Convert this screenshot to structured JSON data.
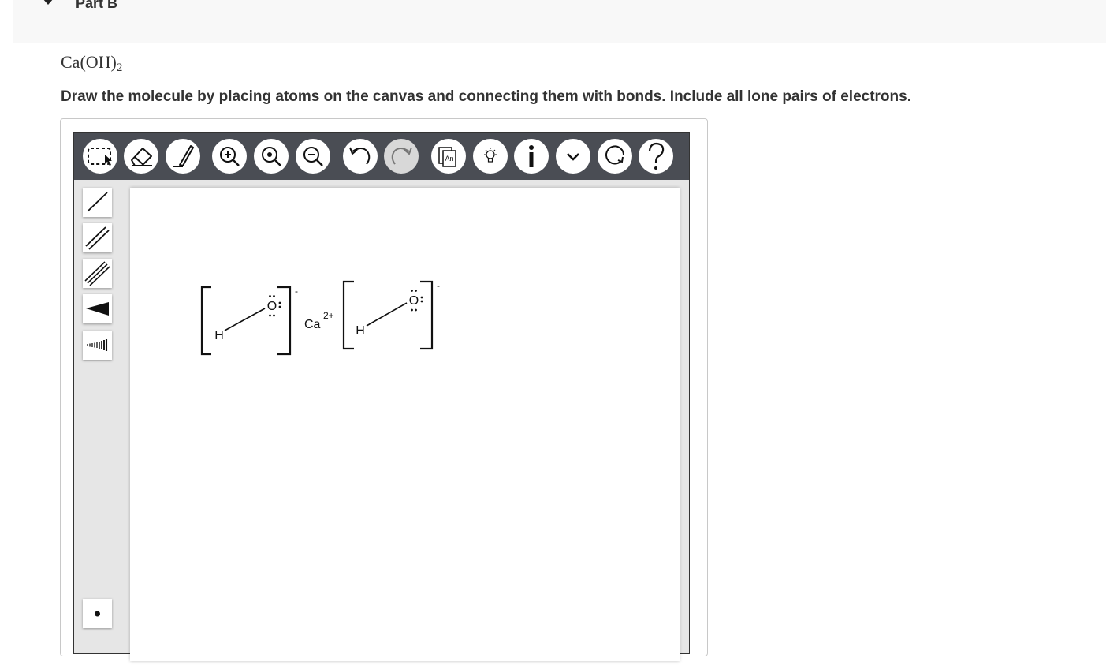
{
  "part": {
    "title": "Part B"
  },
  "question": {
    "formula_main": "Ca(OH)",
    "formula_subscript": "2",
    "instruction": "Draw the molecule by placing atoms on the canvas and connecting them with bonds. Include all lone pairs of electrons."
  },
  "toolbar": {
    "template_label": "An",
    "buttons": [
      {
        "name": "select-tool",
        "icon": "marquee-select-icon"
      },
      {
        "name": "eraser-tool",
        "icon": "eraser-icon"
      },
      {
        "name": "draw-tool",
        "icon": "pen-icon"
      },
      {
        "name": "zoom-in",
        "icon": "zoom-in-icon"
      },
      {
        "name": "zoom-reset",
        "icon": "zoom-fit-icon"
      },
      {
        "name": "zoom-out",
        "icon": "zoom-out-icon"
      },
      {
        "name": "undo",
        "icon": "undo-icon"
      },
      {
        "name": "redo",
        "icon": "redo-icon",
        "disabled": true
      },
      {
        "name": "templates",
        "icon": "template-icon"
      },
      {
        "name": "hint",
        "icon": "lightbulb-icon"
      },
      {
        "name": "info",
        "icon": "info-icon"
      },
      {
        "name": "more",
        "icon": "chevron-down-icon"
      },
      {
        "name": "reset",
        "icon": "reset-icon"
      },
      {
        "name": "help",
        "icon": "help-icon"
      }
    ]
  },
  "bond_tools": [
    {
      "name": "single-bond",
      "icon": "single-bond-icon"
    },
    {
      "name": "double-bond",
      "icon": "double-bond-icon"
    },
    {
      "name": "triple-bond",
      "icon": "triple-bond-icon"
    },
    {
      "name": "wedge-bond",
      "icon": "wedge-bond-icon"
    },
    {
      "name": "hash-bond",
      "icon": "hash-bond-icon"
    },
    {
      "name": "lone-electron",
      "icon": "dot-icon"
    }
  ],
  "drawing": {
    "hydroxide_1": {
      "hydrogen": "H",
      "oxygen": "O",
      "charge": "-"
    },
    "calcium": {
      "symbol": "Ca",
      "charge": "2+"
    },
    "hydroxide_2": {
      "hydrogen": "H",
      "oxygen": "O",
      "charge": "-"
    }
  },
  "colors": {
    "toolbar": "#4a4d54",
    "panel": "#e6e6e6",
    "header": "#f8f8f8"
  }
}
